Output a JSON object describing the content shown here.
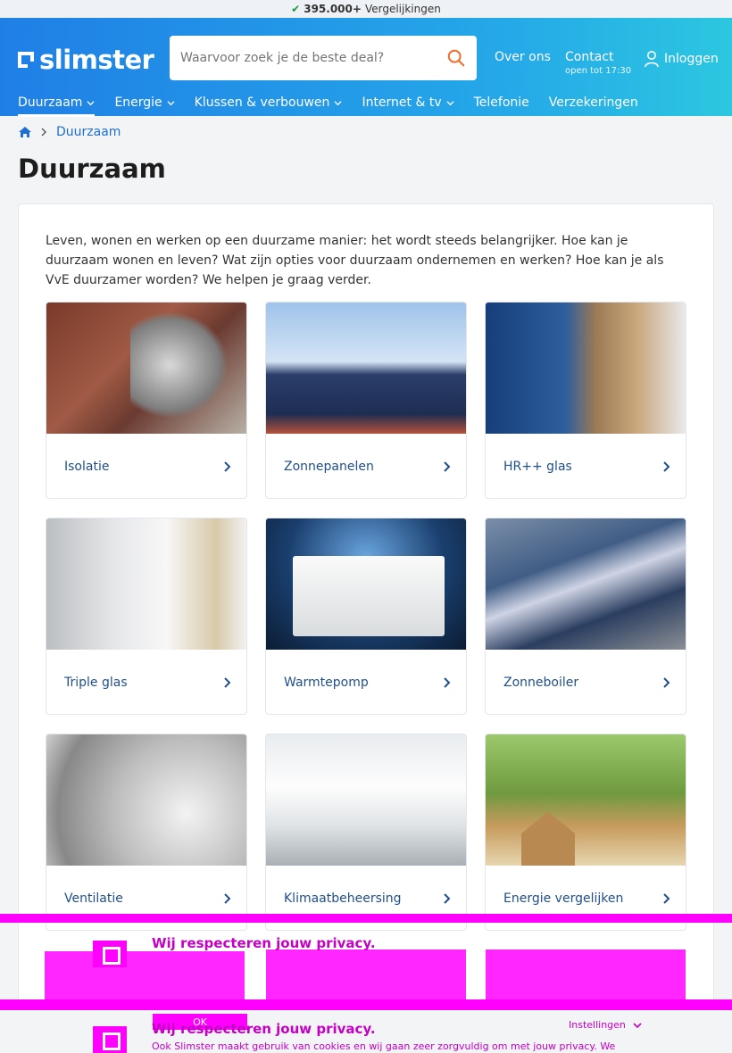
{
  "topstrip": {
    "count": "395.000+",
    "text": "Vergelijkingen"
  },
  "header": {
    "logo": "slimster",
    "search_placeholder": "Waarvoor zoek je de beste deal?",
    "links": {
      "over": "Over ons",
      "contact": "Contact",
      "contact_sub": "open tot 17:30",
      "login": "Inloggen"
    },
    "colors": {
      "gradient_start": "#1f7fe6",
      "gradient_end": "#2cc7e0",
      "search_icon": "#f26b2a"
    }
  },
  "nav": {
    "items": [
      {
        "label": "Duurzaam",
        "has_dropdown": true,
        "active": true
      },
      {
        "label": "Energie",
        "has_dropdown": true
      },
      {
        "label": "Klussen & verbouwen",
        "has_dropdown": true
      },
      {
        "label": "Internet & tv",
        "has_dropdown": true
      },
      {
        "label": "Telefonie",
        "has_dropdown": false
      },
      {
        "label": "Verzekeringen",
        "has_dropdown": false
      }
    ]
  },
  "breadcrumb": {
    "current": "Duurzaam"
  },
  "page": {
    "title": "Duurzaam",
    "intro": "Leven, wonen en werken op een duurzame manier: het wordt steeds belangrijker. Hoe kan je duurzaam wonen en leven? Wat zijn opties voor duurzaam ondernemen en werken? Hoe kan je als VvE duurzamer worden? We helpen je graag verder."
  },
  "tiles": [
    {
      "label": "Isolatie"
    },
    {
      "label": "Zonnepanelen"
    },
    {
      "label": "HR++ glas"
    },
    {
      "label": "Triple glas"
    },
    {
      "label": "Warmtepomp"
    },
    {
      "label": "Zonneboiler"
    },
    {
      "label": "Ventilatie"
    },
    {
      "label": "Klimaatbeheersing"
    },
    {
      "label": "Energie vergelijken"
    }
  ],
  "cookie": {
    "title": "Wij respecteren jouw privacy.",
    "text": "Ook Slimster maakt gebruik van cookies en wij gaan zeer zorgvuldig om met jouw privacy. We",
    "ok": "OK",
    "settings": "Instellingen",
    "overlay_color": "#ff00ff"
  }
}
